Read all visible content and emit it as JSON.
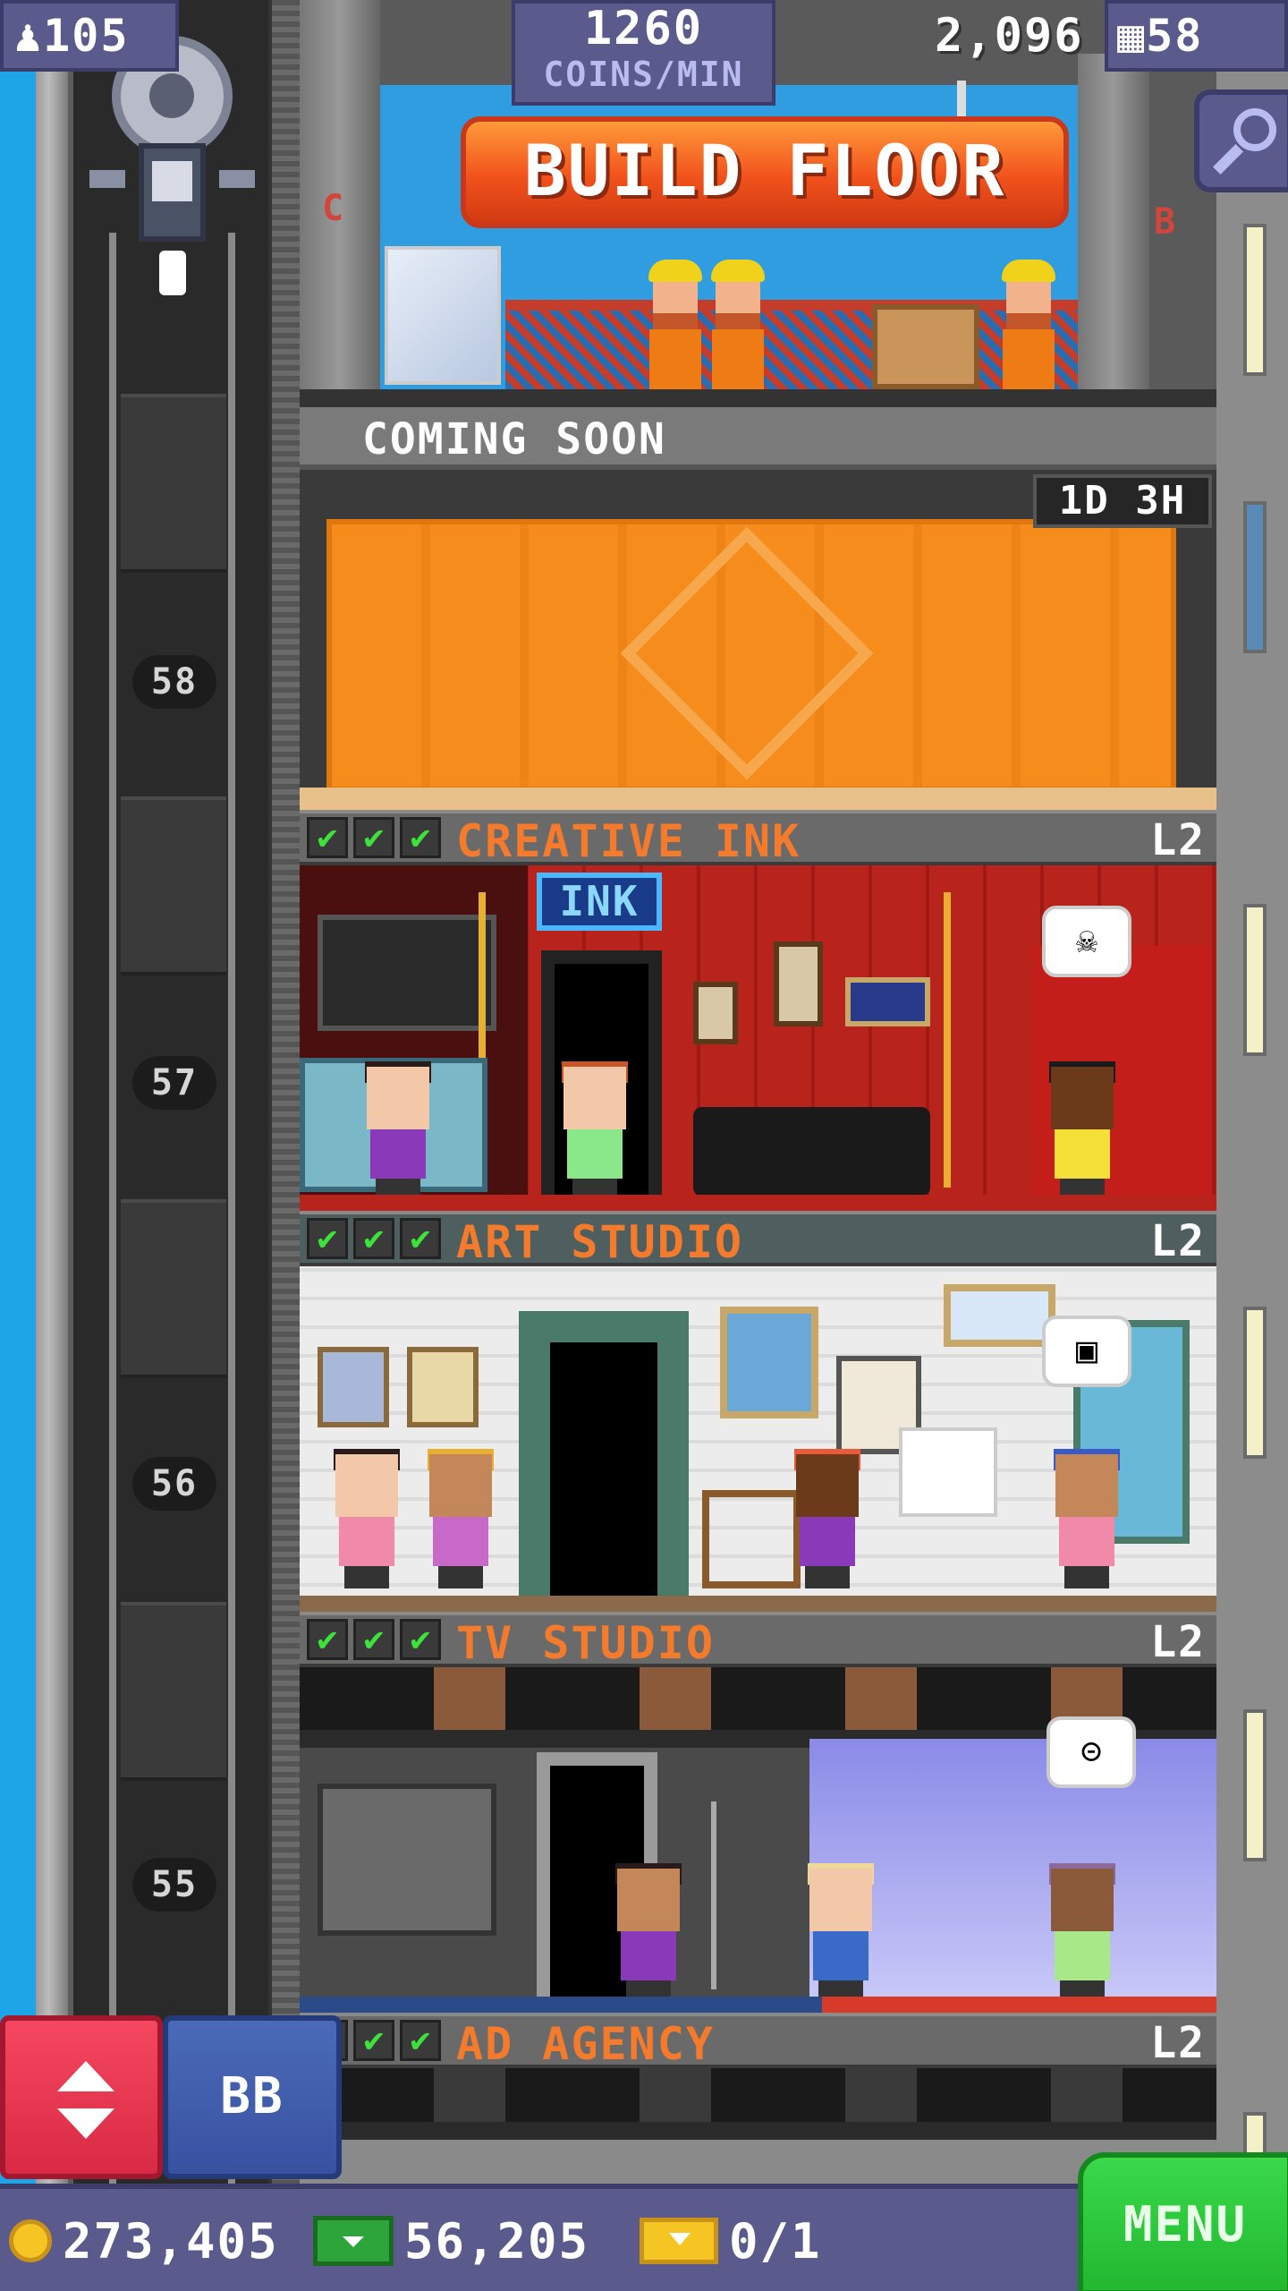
{
  "hud": {
    "population": "105",
    "coins_per_min_value": "1260",
    "coins_per_min_label": "COINS/MIN",
    "coin_income_float": "2,096",
    "floor_count": "58"
  },
  "construction": {
    "build_button_label": "BUILD FLOOR",
    "sign_left": "C",
    "sign_right": "B"
  },
  "coming_soon": {
    "label": "COMING SOON",
    "timer": "1D 3H"
  },
  "floors": [
    {
      "name": "CREATIVE INK",
      "level": "L2",
      "number": "58",
      "checks": [
        "✔",
        "✔",
        "✔"
      ],
      "sign": "INK",
      "bubble": "☠"
    },
    {
      "name": "ART STUDIO",
      "level": "L2",
      "number": "57",
      "checks": [
        "✔",
        "✔",
        "✔"
      ],
      "bubble": "▣"
    },
    {
      "name": "TV STUDIO",
      "level": "L2",
      "number": "56",
      "checks": [
        "✔",
        "✔",
        "✔"
      ],
      "bubble": "⊝"
    },
    {
      "name": "AD AGENCY",
      "level": "L2",
      "number": "55",
      "checks": [
        "✔",
        "✔",
        "✔"
      ]
    }
  ],
  "controls": {
    "bb_label": "BB",
    "menu_label": "MENU"
  },
  "wallet": {
    "coins": "273,405",
    "bux": "56,205",
    "tickets": "0/1"
  },
  "icons": {
    "population": "person-icon",
    "floors": "building-icon",
    "search": "magnifier-icon",
    "elevator": "up-down-arrows-icon",
    "coins": "coin-icon",
    "bux": "bux-icon",
    "tickets": "ticket-icon"
  },
  "colors": {
    "hud": "#5a5a8c",
    "room_name": "#f47a2c",
    "check": "#3ee23a",
    "build_button": "#f1521c",
    "menu_button": "#22b830",
    "elevator_button": "#d82a44",
    "bb_button": "#3852a0",
    "sky": "#1ea5e8"
  }
}
